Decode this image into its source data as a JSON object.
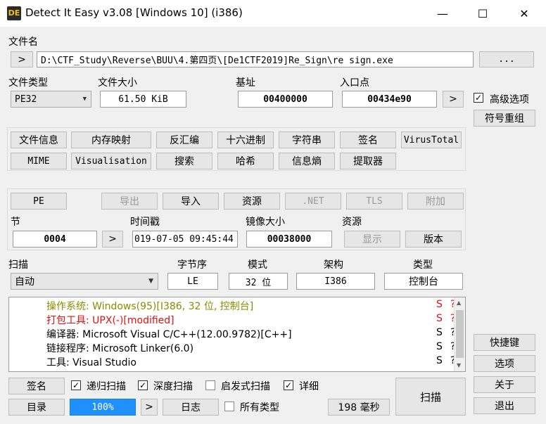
{
  "window": {
    "title": "Detect It Easy v3.08 [Windows 10] (i386)",
    "minimize_glyph": "—",
    "maximize_glyph": "☐",
    "close_glyph": "✕"
  },
  "file": {
    "label": "文件名",
    "path": "D:\\CTF_Study\\Reverse\\BUU\\4.第四页\\[De1CTF2019]Re_Sign\\re sign.exe",
    "go_label": ">",
    "browse_label": "..."
  },
  "info": {
    "type_label": "文件类型",
    "type_value": "PE32",
    "size_label": "文件大小",
    "size_value": "61.50 KiB",
    "base_label": "基址",
    "base_value": "00400000",
    "entry_label": "入口点",
    "entry_value": "00434e90",
    "entry_go_label": ">",
    "advanced_label": "高级选项",
    "advanced_checked": true,
    "symbol_button": "符号重组"
  },
  "tools": {
    "row1": [
      "文件信息",
      "内存映射",
      "反汇编",
      "十六进制",
      "字符串",
      "签名",
      "VirusTotal"
    ],
    "row2": [
      "MIME",
      "Visualisation",
      "搜索",
      "哈希",
      "信息熵",
      "提取器"
    ]
  },
  "pe": {
    "buttons": [
      {
        "label": "PE",
        "disabled": false
      },
      {
        "label": "导出",
        "disabled": true
      },
      {
        "label": "导入",
        "disabled": false
      },
      {
        "label": "资源",
        "disabled": false
      },
      {
        "label": ".NET",
        "disabled": true
      },
      {
        "label": "TLS",
        "disabled": true
      },
      {
        "label": "附加",
        "disabled": true
      }
    ],
    "section_label": "节",
    "section_value": "0004",
    "section_go": ">",
    "time_label": "时间戳",
    "time_value": "019-07-05 09:45:44",
    "image_size_label": "镜像大小",
    "image_size_value": "00038000",
    "resources_label": "资源",
    "show_button": "显示",
    "version_button": "版本"
  },
  "scan": {
    "label": "扫描",
    "mode_value": "自动",
    "endian_label": "字节序",
    "endian_value": "LE",
    "mode_label": "模式",
    "bits_value": "32 位",
    "arch_label": "架构",
    "arch_value": "I386",
    "type_label": "类型",
    "type_value": "控制台"
  },
  "results": [
    {
      "text": "操作系统: Windows(95)[I386, 32 位, 控制台]",
      "color": "#8b8b00",
      "s": "S",
      "q": "?"
    },
    {
      "text": "打包工具: UPX(-)[modified]",
      "color": "#e01010",
      "s": "S",
      "q": "?"
    },
    {
      "text": "编译器: Microsoft Visual C/C++(12.00.9782)[C++]",
      "color": "#000000",
      "s": "S",
      "q": "?"
    },
    {
      "text": "链接程序: Microsoft Linker(6.0)",
      "color": "#000000",
      "s": "S",
      "q": "?"
    },
    {
      "text": "工具: Visual Studio",
      "color": "#000000",
      "s": "S",
      "q": "?"
    }
  ],
  "bottom": {
    "signature_button": "签名",
    "recursive_label": "递归扫描",
    "deep_label": "深度扫描",
    "heuristic_label": "启发式扫描",
    "verbose_label": "详细",
    "directory_button": "目录",
    "progress_text": "100%",
    "progress_value": 1.0,
    "progress_go": ">",
    "log_button": "日志",
    "all_types_label": "所有类型",
    "time_text": "198 毫秒",
    "scan_button": "扫描"
  },
  "side": {
    "shortcuts": "快捷键",
    "options": "选项",
    "about": "关于",
    "exit": "退出"
  },
  "colors": {
    "accent": "#1e90ff",
    "warning_red": "#e01010",
    "os_olive": "#8b8b00"
  }
}
